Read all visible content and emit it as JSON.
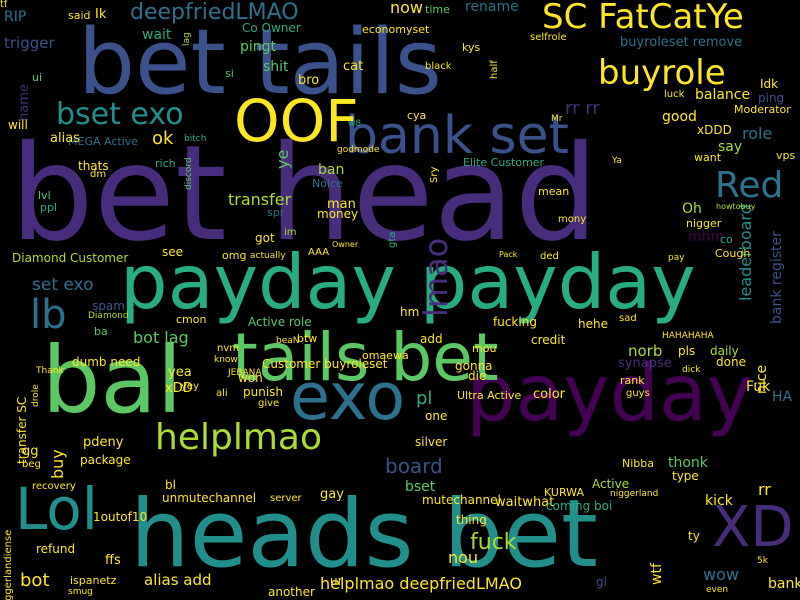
{
  "palette": {
    "background": "#000000",
    "colors": [
      "#440154",
      "#472d7b",
      "#3b518b",
      "#2c718e",
      "#21908d",
      "#27ad81",
      "#5cc863",
      "#aadc32",
      "#fde725"
    ]
  },
  "words": [
    {
      "text": "bet head"
    },
    {
      "text": "bet tails"
    },
    {
      "text": "heads bet"
    },
    {
      "text": "bal"
    },
    {
      "text": "payday payday"
    },
    {
      "text": "payday"
    },
    {
      "text": "tails bet"
    },
    {
      "text": "exo"
    },
    {
      "text": "Lol"
    },
    {
      "text": "XD"
    },
    {
      "text": "bank set"
    },
    {
      "text": "OOF"
    },
    {
      "text": "SC FatCatYe"
    },
    {
      "text": "buyrole"
    },
    {
      "text": "bset exo"
    },
    {
      "text": "helplmao"
    },
    {
      "text": "lb"
    },
    {
      "text": "Red"
    },
    {
      "text": "lmao"
    },
    {
      "text": "deepfriedLMAO"
    },
    {
      "text": "board"
    },
    {
      "text": "fuck"
    },
    {
      "text": "RIP"
    },
    {
      "text": "trigger"
    },
    {
      "text": "wait"
    },
    {
      "text": "Ik"
    },
    {
      "text": "now"
    },
    {
      "text": "time"
    },
    {
      "text": "rename"
    },
    {
      "text": "pingt"
    },
    {
      "text": "shit"
    },
    {
      "text": "bro"
    },
    {
      "text": "cat"
    },
    {
      "text": "buyroleset remove"
    },
    {
      "text": "rr rr"
    },
    {
      "text": "good"
    },
    {
      "text": "role"
    },
    {
      "text": "say"
    },
    {
      "text": "leaderboard"
    },
    {
      "text": "bank register"
    },
    {
      "text": "transfer"
    },
    {
      "text": "man"
    },
    {
      "text": "ye"
    },
    {
      "text": "ban"
    },
    {
      "text": "Oh"
    },
    {
      "text": "balance"
    },
    {
      "text": "ping"
    },
    {
      "text": "Idk"
    },
    {
      "text": "xDDD"
    },
    {
      "text": "Moderator"
    },
    {
      "text": "set exo"
    },
    {
      "text": "Diamond Customer"
    },
    {
      "text": "omg"
    },
    {
      "text": "Active role"
    },
    {
      "text": "bot lag"
    },
    {
      "text": "mhm"
    },
    {
      "text": "co"
    },
    {
      "text": "norb"
    },
    {
      "text": "pls"
    },
    {
      "text": "daily"
    },
    {
      "text": "done"
    },
    {
      "text": "nice"
    },
    {
      "text": "synapse"
    },
    {
      "text": "rank"
    },
    {
      "text": "Fuk"
    },
    {
      "text": "HA"
    },
    {
      "text": "ok"
    },
    {
      "text": "thats"
    },
    {
      "text": "see"
    },
    {
      "text": "got"
    },
    {
      "text": "spr"
    },
    {
      "text": "money"
    },
    {
      "text": "Customer buyroleset"
    },
    {
      "text": "pl"
    },
    {
      "text": "Ultra Active"
    },
    {
      "text": "color"
    },
    {
      "text": "gonna"
    },
    {
      "text": "die"
    },
    {
      "text": "credit"
    },
    {
      "text": "fucking"
    },
    {
      "text": "mou"
    },
    {
      "text": "yea"
    },
    {
      "text": "xDD"
    },
    {
      "text": "won"
    },
    {
      "text": "dumb need"
    },
    {
      "text": "pdeny"
    },
    {
      "text": "package"
    },
    {
      "text": "gay"
    },
    {
      "text": "bset"
    },
    {
      "text": "mutechannel"
    },
    {
      "text": "unmutechannel"
    },
    {
      "text": "server"
    },
    {
      "text": "waitwhat"
    },
    {
      "text": "thonk"
    },
    {
      "text": "type"
    },
    {
      "text": "kick"
    },
    {
      "text": "rr"
    },
    {
      "text": "ty"
    },
    {
      "text": "wow"
    },
    {
      "text": "bank"
    },
    {
      "text": "wtf"
    },
    {
      "text": "gl"
    },
    {
      "text": "helplmao deepfriedLMAO"
    },
    {
      "text": "alias add"
    },
    {
      "text": "ispanetz"
    },
    {
      "text": "bot"
    },
    {
      "text": "ffs"
    },
    {
      "text": "refund"
    },
    {
      "text": "nou"
    },
    {
      "text": "ur"
    },
    {
      "text": "another"
    },
    {
      "text": "KURWA"
    },
    {
      "text": "Active"
    },
    {
      "text": "thing"
    },
    {
      "text": "buy"
    },
    {
      "text": "gg"
    },
    {
      "text": "beg"
    },
    {
      "text": "recovery"
    },
    {
      "text": "transfer SC"
    },
    {
      "text": "Co Owner"
    },
    {
      "text": "economyset"
    },
    {
      "text": "selfrole"
    },
    {
      "text": "kys"
    },
    {
      "text": "half"
    },
    {
      "text": "MEGA Active"
    },
    {
      "text": "Elite Customer"
    },
    {
      "text": "Noice"
    },
    {
      "text": "vps"
    },
    {
      "text": "want"
    },
    {
      "text": "mean"
    },
    {
      "text": "gta"
    },
    {
      "text": "im"
    },
    {
      "text": "Owner"
    },
    {
      "text": "AAA"
    },
    {
      "text": "ded"
    },
    {
      "text": "Pack"
    },
    {
      "text": "nigger"
    },
    {
      "text": "howtobuy"
    },
    {
      "text": "Cough"
    },
    {
      "text": "cya"
    },
    {
      "text": "godmode"
    },
    {
      "text": "rich"
    },
    {
      "text": "dm"
    },
    {
      "text": "lvl"
    },
    {
      "text": "ppl"
    },
    {
      "text": "name"
    },
    {
      "text": "will"
    },
    {
      "text": "alias"
    },
    {
      "text": "ui"
    },
    {
      "text": "said"
    },
    {
      "text": "lag"
    },
    {
      "text": "si"
    },
    {
      "text": "black"
    },
    {
      "text": "luck"
    },
    {
      "text": "Mr"
    },
    {
      "text": "w8"
    },
    {
      "text": "bitch"
    },
    {
      "text": "discord"
    },
    {
      "text": "Sry"
    },
    {
      "text": "Ya"
    },
    {
      "text": "mony"
    },
    {
      "text": "pay"
    },
    {
      "text": "actually"
    },
    {
      "text": "spam"
    },
    {
      "text": "Diamond"
    },
    {
      "text": "ba"
    },
    {
      "text": "cmon"
    },
    {
      "text": "nvm"
    },
    {
      "text": "know"
    },
    {
      "text": "JEBANA"
    },
    {
      "text": "beaN"
    },
    {
      "text": "btw"
    },
    {
      "text": "add"
    },
    {
      "text": "hm"
    },
    {
      "text": "hehe"
    },
    {
      "text": "sad"
    },
    {
      "text": "HAHAHAHA"
    },
    {
      "text": "Thank"
    },
    {
      "text": "yey"
    },
    {
      "text": "ali"
    },
    {
      "text": "punish"
    },
    {
      "text": "omaewa"
    },
    {
      "text": "one"
    },
    {
      "text": "give"
    },
    {
      "text": "drole"
    },
    {
      "text": "silver"
    },
    {
      "text": "guys"
    },
    {
      "text": "dick"
    },
    {
      "text": "Nibba"
    },
    {
      "text": "niggerland"
    },
    {
      "text": "coming boi"
    },
    {
      "text": "1outof10"
    },
    {
      "text": "5k"
    },
    {
      "text": "smug"
    },
    {
      "text": "even"
    },
    {
      "text": "niggerlandiense"
    },
    {
      "text": "bl"
    },
    {
      "text": "tf"
    }
  ]
}
